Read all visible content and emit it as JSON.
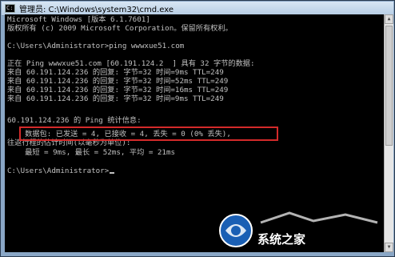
{
  "window": {
    "title": "管理员: C:\\Windows\\system32\\cmd.exe",
    "icon": "cmd-icon"
  },
  "console": {
    "lines": [
      "Microsoft Windows [版本 6.1.7601]",
      "版权所有 (c) 2009 Microsoft Corporation。保留所有权利。",
      "",
      "C:\\Users\\Administrator>ping wwwxue51.com",
      "",
      "正在 Ping wwwxue51.com [60.191.124.2  ] 具有 32 字节的数据:",
      "来自 60.191.124.236 的回复: 字节=32 时间=9ms TTL=249",
      "来自 60.191.124.236 的回复: 字节=32 时间=52ms TTL=249",
      "来自 60.191.124.236 的回复: 字节=32 时间=16ms TTL=249",
      "来自 60.191.124.236 的回复: 字节=32 时间=9ms TTL=249",
      "",
      "60.191.124.236 的 Ping 统计信息:",
      "    数据包: 已发送 = 4, 已接收 = 4, 丢失 = 0 (0% 丢失),",
      "往返行程的估计时间(以毫秒为单位):",
      "    最短 = 9ms, 最长 = 52ms, 平均 = 21ms",
      "",
      "C:\\Users\\Administrator>"
    ]
  },
  "watermark": {
    "text": "系统之家",
    "logo": "xitong-logo-icon"
  },
  "colors": {
    "console_bg": "#000000",
    "console_text": "#c0c0c0",
    "highlight": "#d42a2a"
  }
}
